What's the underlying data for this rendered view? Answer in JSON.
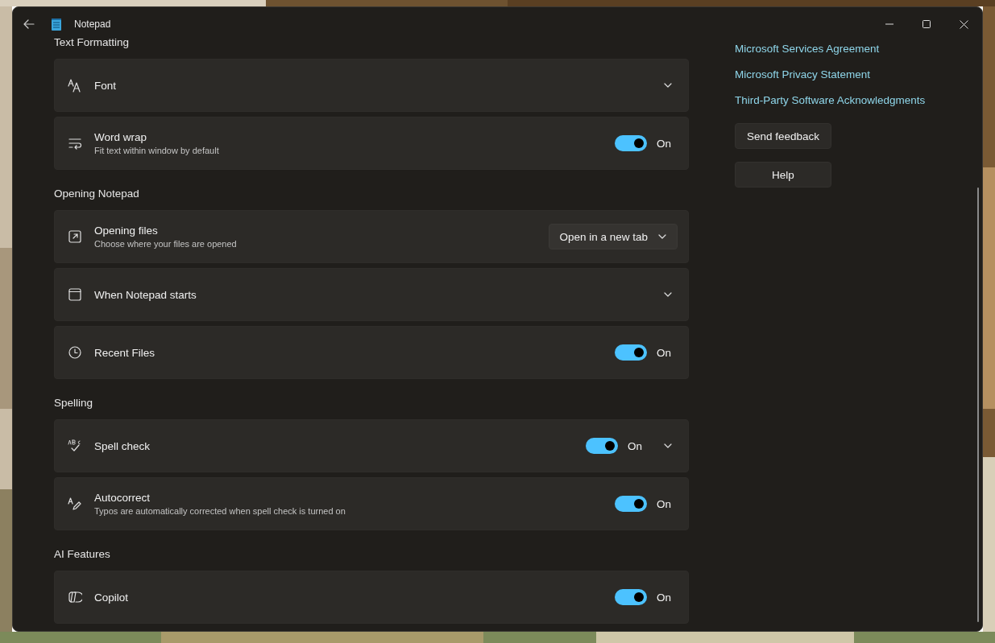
{
  "window": {
    "title": "Notepad"
  },
  "sections": [
    {
      "heading": "Text Formatting",
      "items": [
        {
          "title": "Font",
          "kind": "expander"
        },
        {
          "title": "Word wrap",
          "description": "Fit text within window by default",
          "kind": "toggle",
          "on": true,
          "state_label": "On"
        }
      ]
    },
    {
      "heading": "Opening Notepad",
      "items": [
        {
          "title": "Opening files",
          "description": "Choose where your files are opened",
          "kind": "select",
          "value": "Open in a new tab"
        },
        {
          "title": "When Notepad starts",
          "kind": "expander"
        },
        {
          "title": "Recent Files",
          "kind": "toggle",
          "on": true,
          "state_label": "On"
        }
      ]
    },
    {
      "heading": "Spelling",
      "items": [
        {
          "title": "Spell check",
          "kind": "toggle_expander",
          "on": true,
          "state_label": "On"
        },
        {
          "title": "Autocorrect",
          "description": "Typos are automatically corrected when spell check is turned on",
          "kind": "toggle",
          "on": true,
          "state_label": "On"
        }
      ]
    },
    {
      "heading": "AI Features",
      "items": [
        {
          "title": "Copilot",
          "kind": "toggle",
          "on": true,
          "state_label": "On"
        }
      ]
    }
  ],
  "links": [
    "Microsoft Services Agreement",
    "Microsoft Privacy Statement",
    "Third-Party Software Acknowledgments"
  ],
  "buttons": [
    "Send feedback",
    "Help"
  ]
}
